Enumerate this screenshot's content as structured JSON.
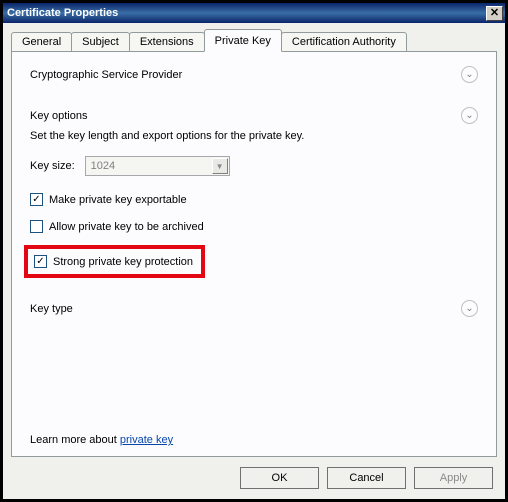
{
  "window": {
    "title": "Certificate Properties"
  },
  "tabs": {
    "items": [
      {
        "label": "General"
      },
      {
        "label": "Subject"
      },
      {
        "label": "Extensions"
      },
      {
        "label": "Private Key"
      },
      {
        "label": "Certification Authority"
      }
    ],
    "active_index": 3
  },
  "sections": {
    "csp": {
      "title": "Cryptographic Service Provider"
    },
    "keyopts": {
      "title": "Key options",
      "hint": "Set the key length and export options for the private key.",
      "keysize_label": "Key size:",
      "keysize_value": "1024",
      "exportable_label": "Make private key exportable",
      "exportable_checked": true,
      "archive_label": "Allow private key to be archived",
      "archive_checked": false,
      "strong_label": "Strong private key protection",
      "strong_checked": true
    },
    "keytype": {
      "title": "Key type"
    }
  },
  "footer": {
    "learn_prefix": "Learn more about ",
    "learn_link": "private key"
  },
  "buttons": {
    "ok": "OK",
    "cancel": "Cancel",
    "apply": "Apply"
  }
}
